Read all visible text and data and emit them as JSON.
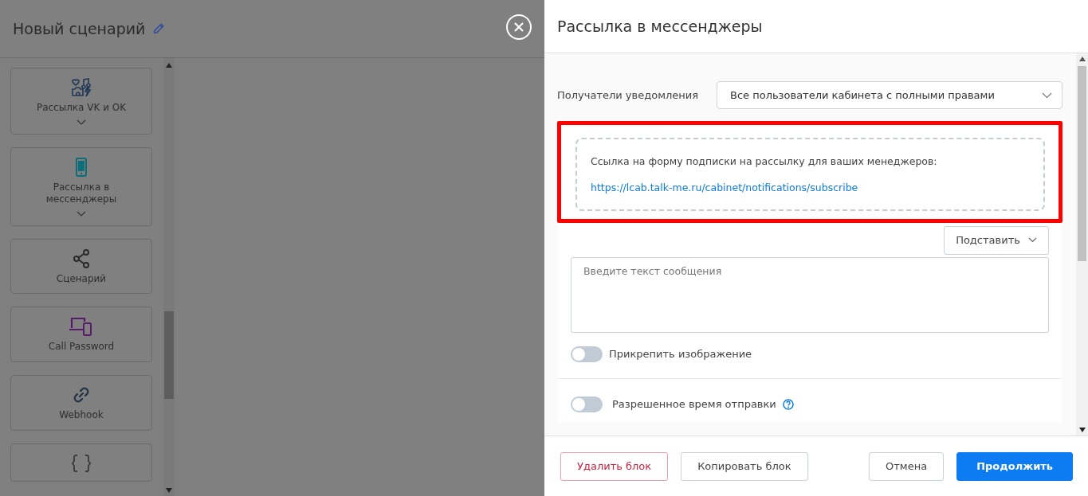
{
  "editor": {
    "title": "Новый сценарий"
  },
  "sidebar": {
    "items": [
      {
        "label": "Рассылка VK и OK",
        "expandable": true
      },
      {
        "label": "Рассылка в мессенджеры",
        "expandable": true
      },
      {
        "label": "Сценарий",
        "expandable": false
      },
      {
        "label": "Call Password",
        "expandable": false
      },
      {
        "label": "Webhook",
        "expandable": false
      },
      {
        "expandable": false
      }
    ]
  },
  "panel": {
    "title": "Рассылка в мессенджеры",
    "recipients": {
      "label": "Получатели уведомления",
      "value": "Все пользователи кабинета с полными правами"
    },
    "subscribe": {
      "text": "Ссылка на форму подписки на рассылку для ваших менеджеров:",
      "link": "https://lcab.talk-me.ru/cabinet/notifications/subscribe"
    },
    "insert_button": "Подставить",
    "message": {
      "placeholder": "Введите текст сообщения"
    },
    "toggles": [
      {
        "label": "Прикрепить изображение",
        "on": false,
        "help": false
      },
      {
        "label": "Разрешенное время отправки",
        "on": false,
        "help": true
      }
    ],
    "footer": {
      "left": [
        {
          "label": "Удалить блок",
          "kind": "danger"
        },
        {
          "label": "Копировать блок",
          "kind": "plain"
        }
      ],
      "right": [
        {
          "label": "Отмена",
          "kind": "plain"
        },
        {
          "label": "Продолжить",
          "kind": "primary"
        }
      ]
    }
  }
}
